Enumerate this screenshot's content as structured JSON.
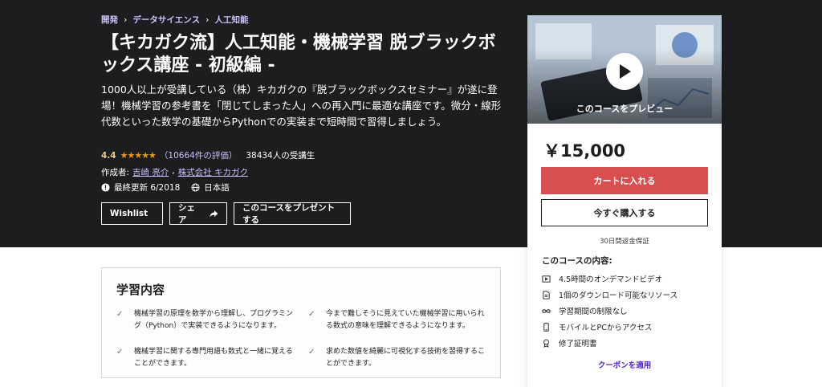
{
  "breadcrumb": [
    "開発",
    "データサイエンス",
    "人工知能"
  ],
  "course": {
    "title": "【キカガク流】人工知能・機械学習 脱ブラックボックス講座 - 初級編 -",
    "subtitle": "1000人以上が受講している（株）キカガクの『脱ブラックボックスセミナー』が遂に登場！機械学習の参考書を「閉じてしまった人」への再入門に最適な講座です。微分・線形代数といった数学の基礎からPythonでの実装まで短時間で習得しましょう。",
    "rating": "4.4",
    "rating_value": 4.4,
    "stars": "★★★★★",
    "review_count": "（10664件の評価）",
    "students": "38434人の受講生",
    "author_prefix": "作成者:",
    "authors": [
      "吉崎 亮介",
      "株式会社 キカガク"
    ],
    "author_sep": ",",
    "last_updated": "最終更新 6/2018",
    "language": "日本語"
  },
  "actions": {
    "wishlist": "Wishlist",
    "share": "シェア",
    "gift": "このコースをプレゼントする"
  },
  "sidebar": {
    "preview_label": "このコースをプレビュー",
    "price": "￥15,000",
    "cart_button": "カートに入れる",
    "buy_button": "今すぐ購入する",
    "guarantee": "30日間返金保証",
    "includes_title": "このコースの内容:",
    "includes": [
      {
        "icon": "video-icon",
        "label": "4.5時間のオンデマンドビデオ"
      },
      {
        "icon": "file-icon",
        "label": "1個のダウンロード可能なリソース"
      },
      {
        "icon": "infinity-icon",
        "label": "学習期間の制限なし"
      },
      {
        "icon": "mobile-icon",
        "label": "モバイルとPCからアクセス"
      },
      {
        "icon": "certificate-icon",
        "label": "修了証明書"
      }
    ],
    "coupon": "クーポンを適用"
  },
  "learn": {
    "title": "学習内容",
    "items": [
      "機械学習の原理を数学から理解し、プログラミング（Python）で実装できるようになります。",
      "今まで難しそうに見えていた機械学習に用いられる数式の意味を理解できるようになります。",
      "機械学習に関する専門用語も数式と一緒に覚えることができます。",
      "求めた数値を綺麗に可視化する技術を習得することができます。"
    ]
  },
  "colors": {
    "hero_bg": "#1c1d1f",
    "link_purple": "#cec0fc",
    "star_orange": "#e59819",
    "cart_red": "#d94f4f",
    "coupon_purple": "#5624d0"
  }
}
